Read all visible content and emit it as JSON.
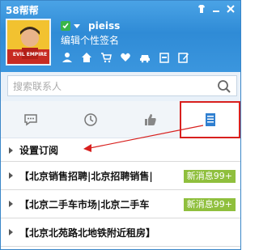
{
  "app": {
    "title": "58帮帮"
  },
  "profile": {
    "username": "pieiss",
    "signature": "编辑个性签名",
    "status_icon": "online-check-icon",
    "avatar_caption": "EVIL EMPIRE"
  },
  "toolbar": {
    "icons": [
      "user-icon",
      "home-icon",
      "cart-icon",
      "heart-icon",
      "car-icon",
      "calendar-icon",
      "edit-icon"
    ]
  },
  "search": {
    "placeholder": "搜索联系人"
  },
  "tabs": [
    {
      "name": "messages",
      "icon": "chat-bubble-icon"
    },
    {
      "name": "recent",
      "icon": "clock-icon"
    },
    {
      "name": "likes",
      "icon": "thumbs-up-icon"
    },
    {
      "name": "subscriptions",
      "icon": "document-list-icon",
      "active": true
    }
  ],
  "list": {
    "subscribe_label": "设置订阅",
    "feeds": [
      {
        "title": "【北京销售招聘|北京招聘销售|",
        "badge": "新消息99+"
      },
      {
        "title": "【北京二手车市场|北京二手车",
        "badge": "新消息99+"
      },
      {
        "title": "【北京北苑路北地铁附近租房】",
        "badge": ""
      }
    ]
  },
  "colors": {
    "header": "#2f8bd6",
    "highlight_border": "#d8201e",
    "badge": "#8fbf3d"
  }
}
